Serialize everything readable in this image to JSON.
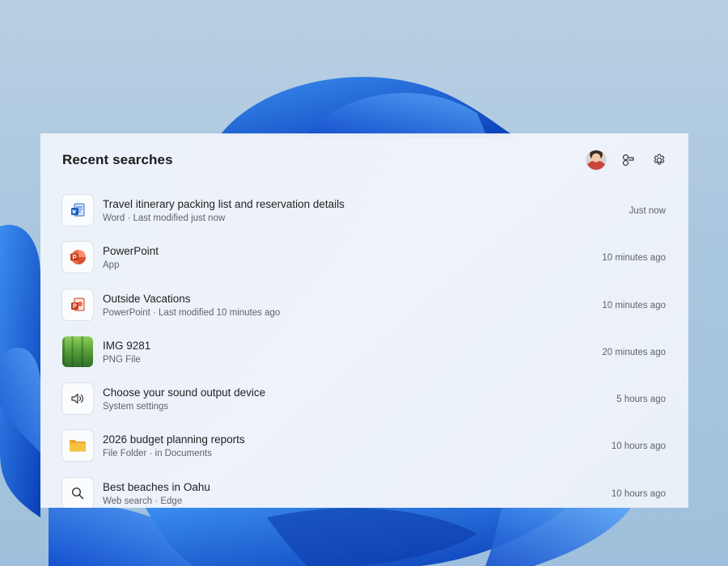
{
  "panel": {
    "title": "Recent searches",
    "actions": [
      {
        "name": "account-avatar",
        "icon": "avatar"
      },
      {
        "name": "connections",
        "icon": "connections-icon"
      },
      {
        "name": "settings",
        "icon": "gear-icon"
      }
    ]
  },
  "items": [
    {
      "title": "Travel itinerary packing list and reservation details",
      "subtitle": "Word · Last modified just now",
      "time": "Just now",
      "icon": "word-icon"
    },
    {
      "title": "PowerPoint",
      "subtitle": "App",
      "time": "10 minutes ago",
      "icon": "powerpoint-app-icon"
    },
    {
      "title": "Outside Vacations",
      "subtitle": "PowerPoint · Last modified 10 minutes ago",
      "time": "10 minutes ago",
      "icon": "powerpoint-file-icon"
    },
    {
      "title": "IMG 9281",
      "subtitle": "PNG File",
      "time": "20 minutes ago",
      "icon": "image-thumbnail"
    },
    {
      "title": "Choose your sound output device",
      "subtitle": "System settings",
      "time": "5 hours ago",
      "icon": "speaker-icon"
    },
    {
      "title": "2026 budget planning reports",
      "subtitle": "File Folder · in Documents",
      "time": "10 hours ago",
      "icon": "folder-icon"
    },
    {
      "title": "Best beaches in Oahu",
      "subtitle": "Web search · Edge",
      "time": "10 hours ago",
      "icon": "search-icon"
    }
  ],
  "colors": {
    "accent": "#1f6fd1",
    "word": "#185abd",
    "powerpoint": "#c43e1c",
    "folder": "#f5c242"
  }
}
